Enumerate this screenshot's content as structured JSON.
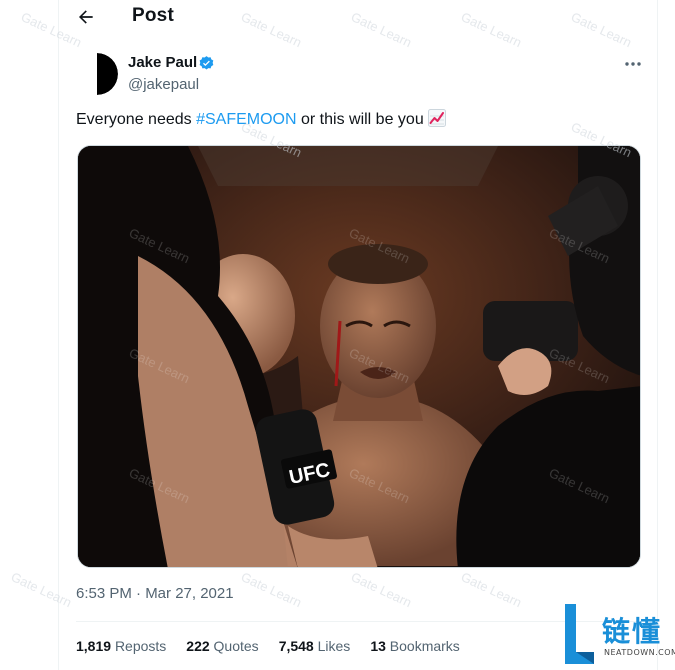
{
  "header": {
    "title": "Post"
  },
  "tweet": {
    "author_name": "Jake Paul",
    "author_handle": "@jakepaul",
    "text_before": "Everyone needs ",
    "hashtag": "#SAFEMOON",
    "text_after": " or this will be you",
    "emoji": "chart-increasing-emoji",
    "media_caption_text": "UFC",
    "timestamp": "6:53 PM · Mar 27, 2021"
  },
  "stats": [
    {
      "count": "1,819",
      "label": "Reposts"
    },
    {
      "count": "222",
      "label": "Quotes"
    },
    {
      "count": "7,548",
      "label": "Likes"
    },
    {
      "count": "13",
      "label": "Bookmarks"
    }
  ],
  "watermark": {
    "text": "Gate Learn"
  },
  "brand_logo": {
    "cn": "链懂",
    "en": "NEATDOWN.COM"
  },
  "colors": {
    "accent": "#1d9bf0",
    "secondary_text": "#536471",
    "brand": "#1a8fd8"
  },
  "icons": {
    "back": "arrow-left-icon",
    "verified": "verified-badge-icon",
    "more": "more-horizontal-icon"
  }
}
